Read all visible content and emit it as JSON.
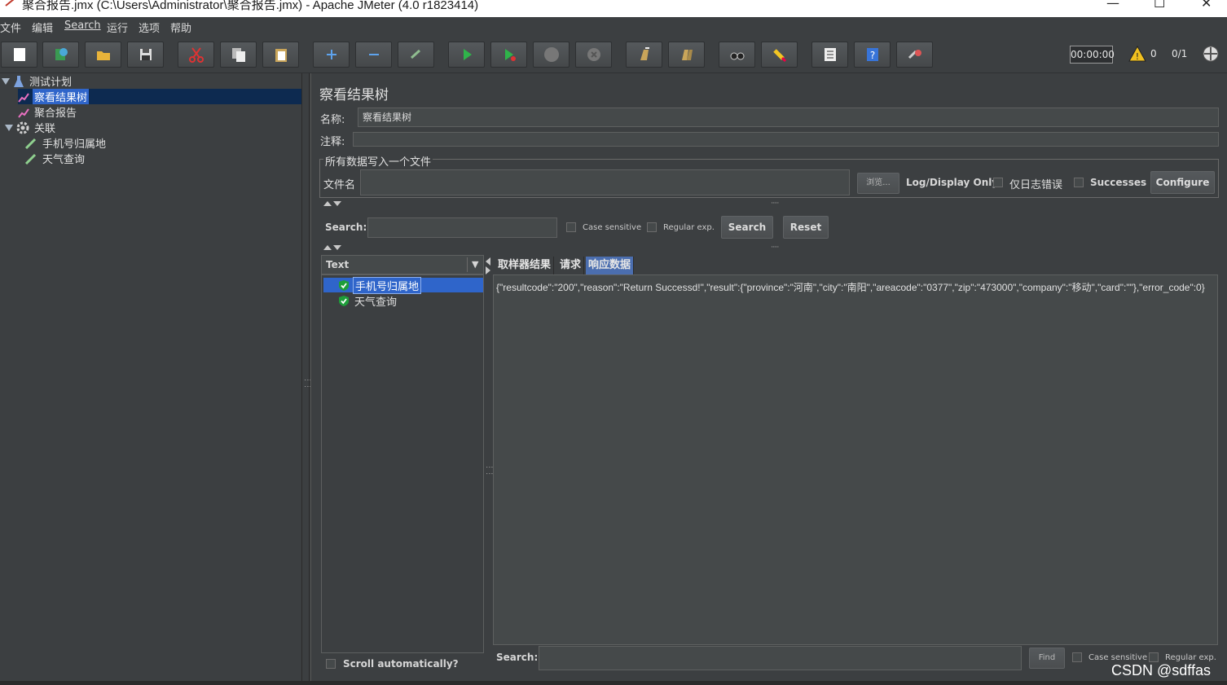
{
  "window": {
    "title": "聚合报告.jmx (C:\\Users\\Administrator\\聚合报告.jmx) - Apache JMeter (4.0 r1823414)"
  },
  "menu": [
    "文件",
    "编辑",
    "Search",
    "运行",
    "选项",
    "帮助"
  ],
  "toolbar": {
    "timer": "00:00:00",
    "warnings": "0",
    "threads": "0/1",
    "buttons": [
      "new-icon",
      "templates-icon",
      "open-icon",
      "save-icon",
      "cut-icon",
      "copy-icon",
      "paste-icon",
      "expand-icon",
      "collapse-icon",
      "toggle-icon",
      "start-icon",
      "start-no-pause-icon",
      "stop-icon",
      "shutdown-icon",
      "clear-icon",
      "clear-all-icon",
      "search-icon",
      "reset-search-icon",
      "function-helper-icon",
      "help-icon",
      "remote-icon"
    ]
  },
  "tree": {
    "items": [
      {
        "label": "测试计划"
      },
      {
        "label": "察看结果树"
      },
      {
        "label": "聚合报告"
      },
      {
        "label": "关联"
      },
      {
        "label": "手机号归属地"
      },
      {
        "label": "天气查询"
      }
    ]
  },
  "panel": {
    "title": "察看结果树",
    "name_label": "名称:",
    "name_value": "察看结果树",
    "comment_label": "注释:",
    "comment_value": "",
    "file_group": "所有数据写入一个文件",
    "filename_label": "文件名",
    "filename_value": "",
    "browse": "浏览...",
    "log_display": "Log/Display Only:",
    "errors_only": "仅日志错误",
    "successes": "Successes",
    "configure": "Configure"
  },
  "search": {
    "label": "Search:",
    "case_sensitive": "Case sensitive",
    "regex": "Regular exp.",
    "search_btn": "Search",
    "reset_btn": "Reset"
  },
  "results": {
    "renderer": "Text",
    "samples": [
      "手机号归属地",
      "天气查询"
    ],
    "scroll_auto": "Scroll automatically?",
    "tabs": [
      "取样器结果",
      "请求",
      "响应数据"
    ],
    "response": "{\"resultcode\":\"200\",\"reason\":\"Return Successd!\",\"result\":{\"province\":\"河南\",\"city\":\"南阳\",\"areacode\":\"0377\",\"zip\":\"473000\",\"company\":\"移动\",\"card\":\"\"},\"error_code\":0}"
  },
  "find": {
    "label": "Search:",
    "find_btn": "Find",
    "case_sensitive": "Case sensitive",
    "regex": "Regular exp."
  },
  "watermark": "CSDN @sdffas"
}
